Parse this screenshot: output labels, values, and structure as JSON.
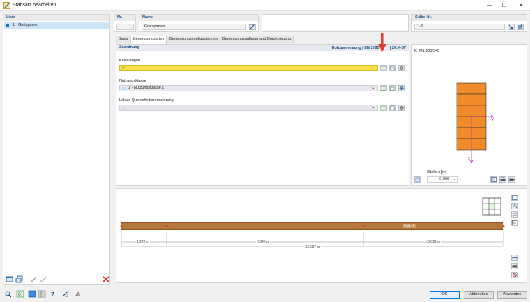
{
  "window": {
    "title": "Stabsatz bearbeiten",
    "minimize": "—",
    "maximize": "☐",
    "close": "✕"
  },
  "list": {
    "header": "Liste",
    "items": [
      {
        "number": "1",
        "name": "Gratsparren",
        "color": "#1f6fc9"
      }
    ]
  },
  "nr": {
    "label": "Nr.",
    "value": "1"
  },
  "name": {
    "label": "Name",
    "value": "Gratsparren"
  },
  "members": {
    "label": "Stäbe Nr.",
    "value": "1-3"
  },
  "tabs": [
    {
      "label": "Basis",
      "active": false
    },
    {
      "label": "Bemessungsarten",
      "active": true
    },
    {
      "label": "Bemessungskonfigurationen",
      "active": false
    },
    {
      "label": "Bemessungsauflager und Durchbiegung",
      "active": false
    }
  ],
  "assignment": {
    "title": "Zuordnung",
    "standard": "Holzbemessung | EN 1995 | [obscured] | 2014-07",
    "standard_left": "Holzbemessung | EN 1995",
    "standard_right": "| 2014-07",
    "buckling": {
      "label": "Knicklängen",
      "value": "--"
    },
    "service_class": {
      "label": "Nutzungsklasse",
      "value": "1 - Nutzungsklasse 1"
    },
    "reduction": {
      "label": "Lokale Querschnittsreduzierung",
      "value": "--"
    }
  },
  "section": {
    "name": "R_M1 100/240",
    "y_axis": "y",
    "z_axis": "z",
    "location_label": "Stelle x [m]",
    "location_value": "0.000"
  },
  "beam": {
    "label": "Nst. 1",
    "dims": [
      "1.222 m",
      "5.346 m",
      "3.819 m"
    ],
    "total": "10.387 m",
    "color": "#b5773b"
  },
  "buttons": {
    "ok": "OK",
    "cancel": "Abbrechen",
    "apply": "Anwenden"
  },
  "colors": {
    "highlight": "#f7e04b",
    "accent": "#1a4c86",
    "arrow": "#e03a2f"
  }
}
